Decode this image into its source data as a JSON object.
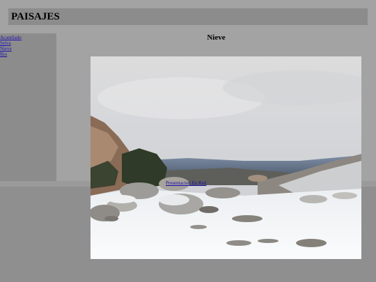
{
  "header": {
    "title": "PAISAJES"
  },
  "sidebar": {
    "links": [
      "Acantilado",
      "Selva",
      "Nieve",
      "Rio"
    ]
  },
  "main": {
    "heading": "Nieve",
    "image_icon": "snow-mountain-photo",
    "overlay_link": "Presentacion En Red"
  },
  "colors": {
    "page_bg": "#8f8f8f",
    "header_bg": "#8c8c8c",
    "link": "#1a0dab"
  }
}
